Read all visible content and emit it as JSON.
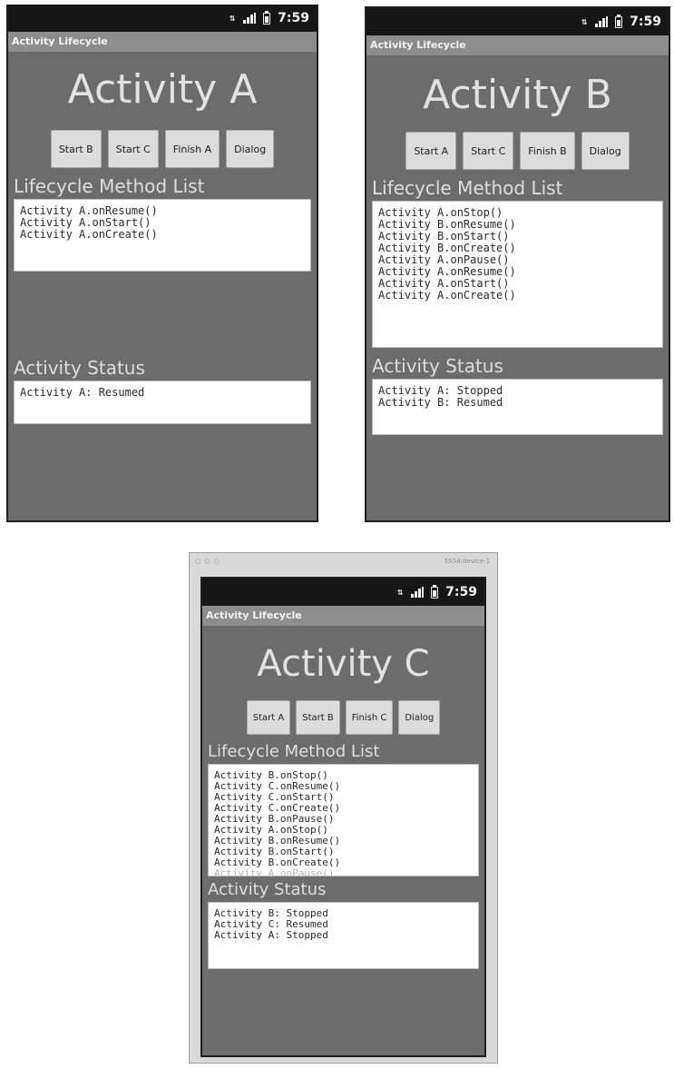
{
  "status_bar": {
    "clock": "7:59",
    "data_icon": "data-activity-icon",
    "signal_icon": "signal-icon",
    "battery_icon": "battery-icon"
  },
  "app": {
    "title": "Activity Lifecycle"
  },
  "emulator_window": {
    "title": "5554:device-1",
    "controls": "○ ○ ○"
  },
  "colors": {
    "screen": "#6c6c6c",
    "status_bar": "#161616",
    "title_bar": "#8d8d8d",
    "button": "#dcdcdc",
    "panel": "#ffffff"
  },
  "labels": {
    "lifecycle": "Lifecycle Method List",
    "status": "Activity Status"
  },
  "screens": {
    "a": {
      "heading": "Activity A",
      "buttons": [
        "Start B",
        "Start C",
        "Finish A",
        "Dialog"
      ],
      "methods": [
        "Activity A.onResume()",
        "Activity A.onStart()",
        "Activity A.onCreate()"
      ],
      "status": [
        "Activity A: Resumed"
      ]
    },
    "b": {
      "heading": "Activity B",
      "buttons": [
        "Start A",
        "Start C",
        "Finish B",
        "Dialog"
      ],
      "methods": [
        "Activity A.onStop()",
        "Activity B.onResume()",
        "Activity B.onStart()",
        "Activity B.onCreate()",
        "Activity A.onPause()",
        "Activity A.onResume()",
        "Activity A.onStart()",
        "Activity A.onCreate()"
      ],
      "status": [
        "Activity A: Stopped",
        "Activity B: Resumed"
      ]
    },
    "c": {
      "heading": "Activity C",
      "buttons": [
        "Start A",
        "Start B",
        "Finish C",
        "Dialog"
      ],
      "methods": [
        "Activity B.onStop()",
        "Activity C.onResume()",
        "Activity C.onStart()",
        "Activity C.onCreate()",
        "Activity B.onPause()",
        "Activity A.onStop()",
        "Activity B.onResume()",
        "Activity B.onStart()",
        "Activity B.onCreate()",
        "Activity A.onPause()"
      ],
      "status": [
        "Activity B: Stopped",
        "Activity C: Resumed",
        "Activity A: Stopped"
      ]
    }
  }
}
